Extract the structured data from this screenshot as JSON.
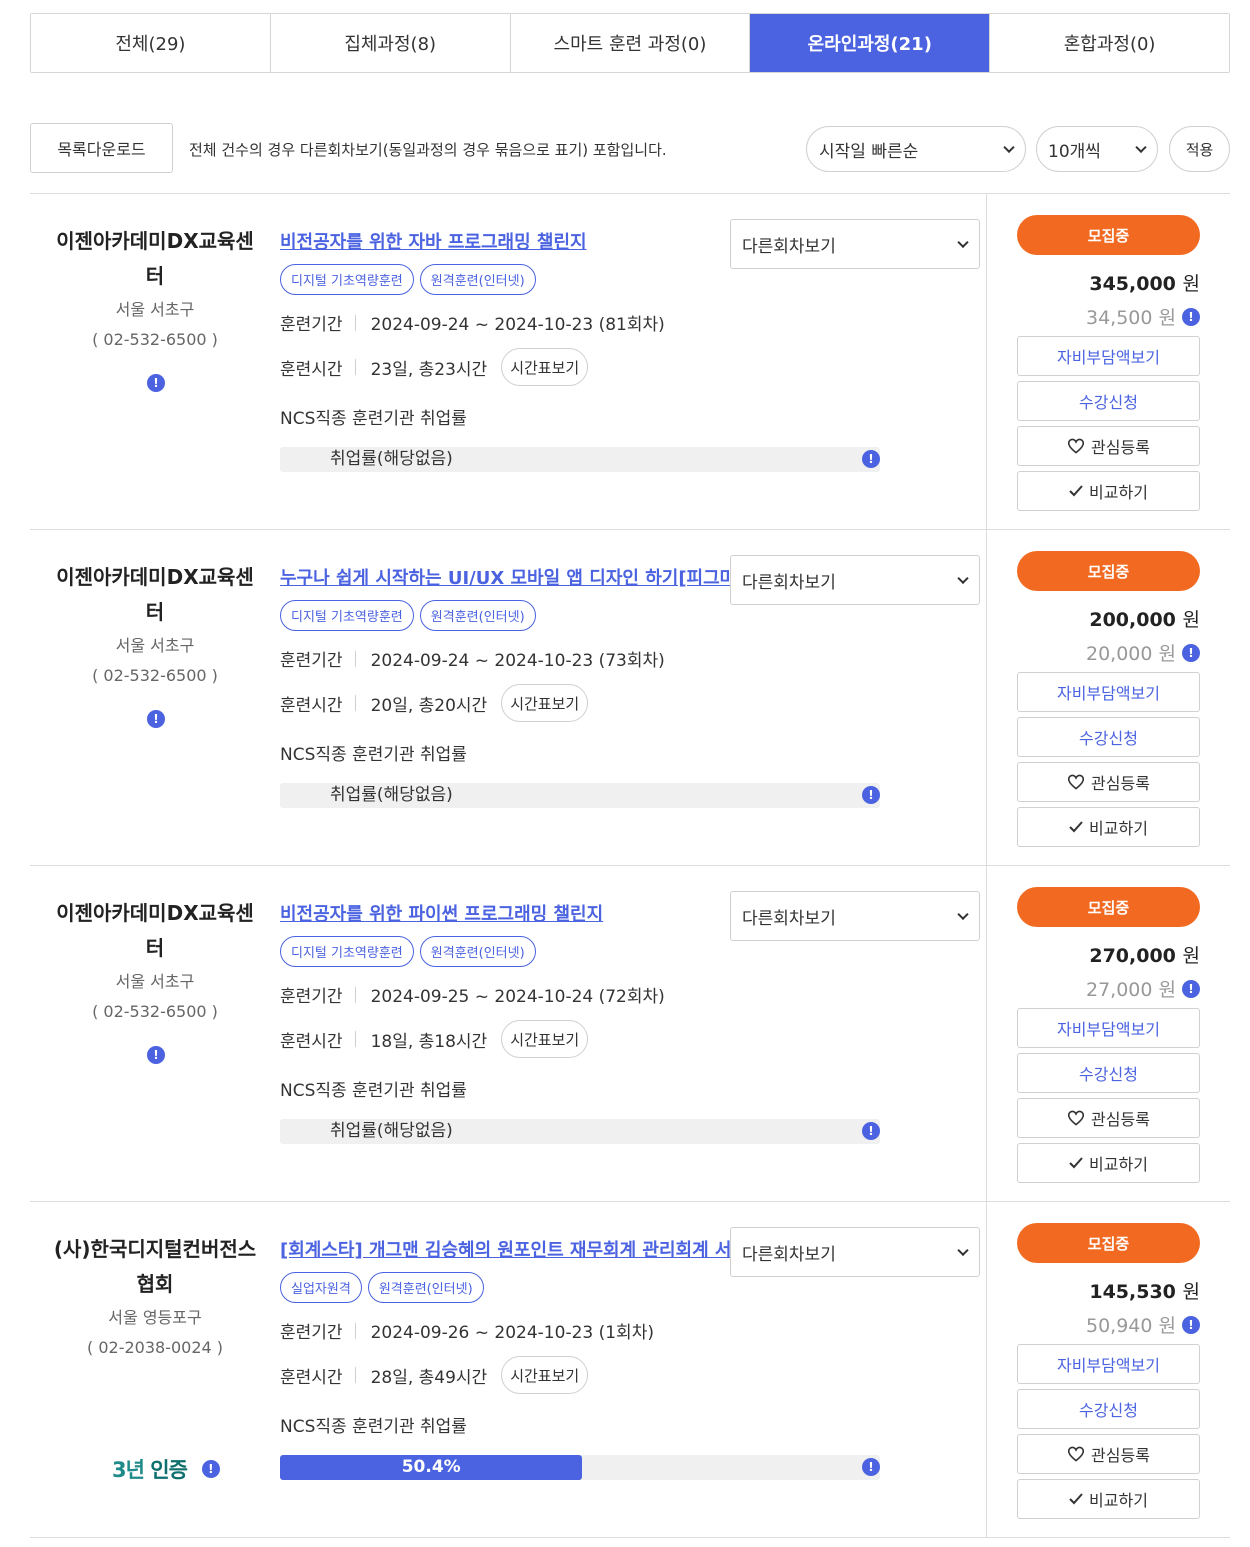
{
  "tabs": [
    {
      "label": "전체(29)",
      "active": false
    },
    {
      "label": "집체과정(8)",
      "active": false
    },
    {
      "label": "스마트 훈련 과정(0)",
      "active": false
    },
    {
      "label": "온라인과정(21)",
      "active": true
    },
    {
      "label": "혼합과정(0)",
      "active": false
    }
  ],
  "toolbar": {
    "download_label": "목록다운로드",
    "note": "전체 건수의 경우 다른회차보기(동일과정의 경우 묶음으로 표기) 포함입니다.",
    "sort_value": "시작일 빠른순",
    "count_value": "10개씩",
    "apply_label": "적용"
  },
  "labels": {
    "period": "훈련기간",
    "hours": "훈련시간",
    "timetable": "시간표보기",
    "ncs": "NCS직종 훈련기관 취업률",
    "other_rounds": "다른회차보기",
    "self_pay": "자비부담액보기",
    "apply": "수강신청",
    "interest": "관심등록",
    "compare": "비교하기",
    "won": "원",
    "info": "!"
  },
  "colors": {
    "accent": "#4b63e0",
    "status": "#f26a22"
  },
  "courses": [
    {
      "org_name": "이젠아카데미DX교육센터",
      "region": "서울 서초구",
      "phone": "( 02-532-6500 )",
      "title": "비전공자를 위한 자바 프로그래밍 챌린지",
      "tags": [
        "디지털 기초역량훈련",
        "원격훈련(인터넷)"
      ],
      "period": "2024-09-24 ~ 2024-10-23 (81회차)",
      "hours": "23일, 총23시간",
      "employment": "취업률(해당없음)",
      "employment_rate": null,
      "status": "모집중",
      "price": "345,000",
      "sub_price": "34,500 원",
      "certified": null
    },
    {
      "org_name": "이젠아카데미DX교육센터",
      "region": "서울 서초구",
      "phone": "( 02-532-6500 )",
      "title": "누구나 쉽게 시작하는 UI/UX 모바일 앱 디자인 하기[피그마",
      "tags": [
        "디지털 기초역량훈련",
        "원격훈련(인터넷)"
      ],
      "period": "2024-09-24 ~ 2024-10-23 (73회차)",
      "hours": "20일, 총20시간",
      "employment": "취업률(해당없음)",
      "employment_rate": null,
      "status": "모집중",
      "price": "200,000",
      "sub_price": "20,000 원",
      "certified": null
    },
    {
      "org_name": "이젠아카데미DX교육센터",
      "region": "서울 서초구",
      "phone": "( 02-532-6500 )",
      "title": "비전공자를 위한 파이썬 프로그래밍 챌린지",
      "tags": [
        "디지털 기초역량훈련",
        "원격훈련(인터넷)"
      ],
      "period": "2024-09-25 ~ 2024-10-24 (72회차)",
      "hours": "18일, 총18시간",
      "employment": "취업률(해당없음)",
      "employment_rate": null,
      "status": "모집중",
      "price": "270,000",
      "sub_price": "27,000 원",
      "certified": null
    },
    {
      "org_name": "(사)한국디지털컨버전스협회",
      "region": "서울 영등포구",
      "phone": "( 02-2038-0024 )",
      "title": "[회계스타] 개그맨 김승혜의 원포인트 재무회계 관리회계 서",
      "tags": [
        "실업자원격",
        "원격훈련(인터넷)"
      ],
      "period": "2024-09-26 ~ 2024-10-23 (1회차)",
      "hours": "28일, 총49시간",
      "employment": "50.4%",
      "employment_rate": 50.4,
      "status": "모집중",
      "price": "145,530",
      "sub_price": "50,940 원",
      "certified": {
        "years": "3년",
        "label": "인증"
      }
    }
  ]
}
